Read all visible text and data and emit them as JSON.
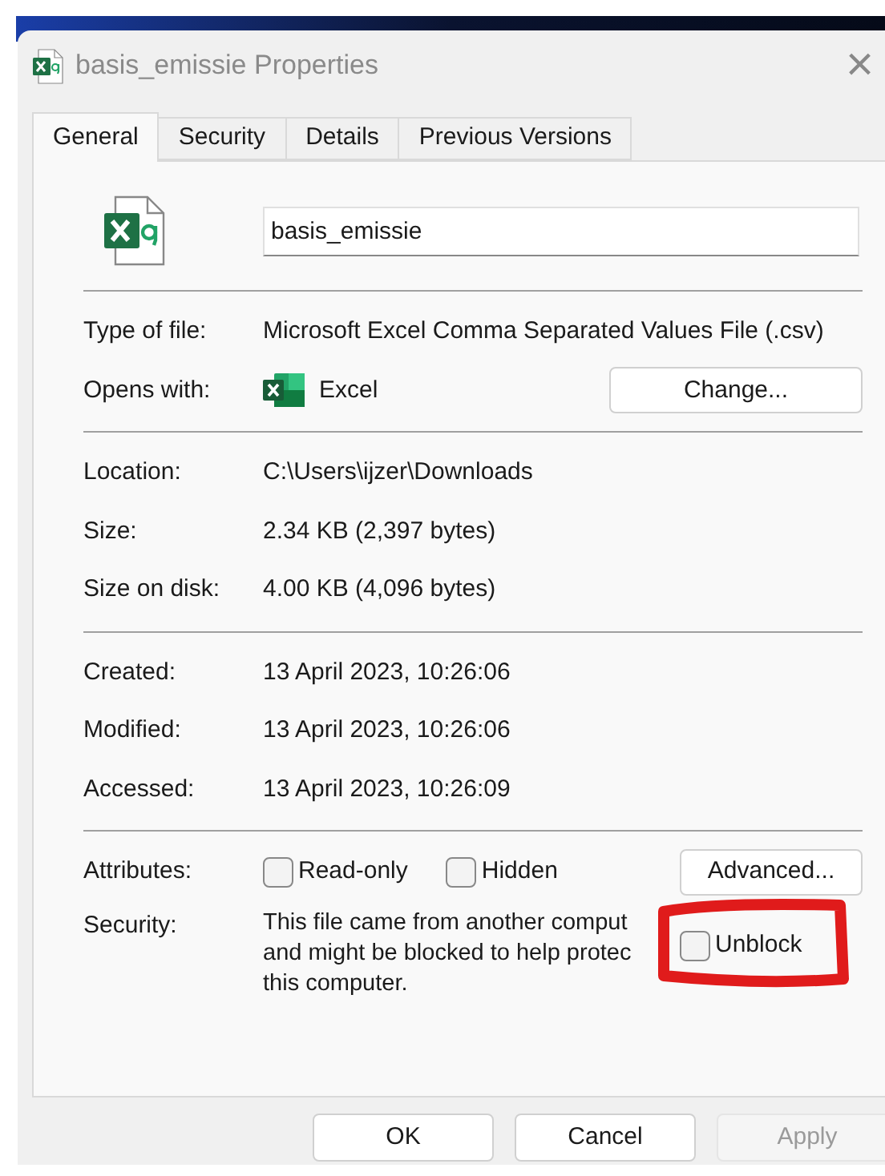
{
  "window": {
    "title": "basis_emissie Properties",
    "close": "×"
  },
  "tabs": [
    {
      "label": "General",
      "selected": true
    },
    {
      "label": "Security",
      "selected": false
    },
    {
      "label": "Details",
      "selected": false
    },
    {
      "label": "Previous Versions",
      "selected": false
    }
  ],
  "file_name": "basis_emissie",
  "groups": [
    [
      {
        "label": "Type of file:",
        "value": "Microsoft Excel Comma Separated Values File (.csv)"
      },
      {
        "label": "Opens with:",
        "value": "Excel",
        "kind": "app",
        "button": "Change..."
      }
    ],
    [
      {
        "label": "Location:",
        "value": "C:\\Users\\ijzer\\Downloads"
      },
      {
        "label": "Size:",
        "value": "2.34 KB (2,397 bytes)"
      },
      {
        "label": "Size on disk:",
        "value": "4.00 KB (4,096 bytes)"
      }
    ],
    [
      {
        "label": "Created:",
        "value": "13 April 2023, 10:26:06"
      },
      {
        "label": "Modified:",
        "value": "13 April 2023, 10:26:06"
      },
      {
        "label": "Accessed:",
        "value": "13 April 2023, 10:26:09"
      }
    ]
  ],
  "attributes": {
    "label": "Attributes:",
    "checkboxes": [
      {
        "label": "Read-only",
        "checked": false
      },
      {
        "label": "Hidden",
        "checked": false
      }
    ],
    "button": "Advanced..."
  },
  "security": {
    "label": "Security:",
    "lines": [
      "This file came from another comput",
      "and might be blocked to help protec",
      "this computer."
    ],
    "unblock": {
      "label": "Unblock",
      "checked": false
    }
  },
  "buttons": [
    {
      "label": "OK",
      "disabled": false
    },
    {
      "label": "Cancel",
      "disabled": false
    },
    {
      "label": "Apply",
      "disabled": true
    }
  ]
}
